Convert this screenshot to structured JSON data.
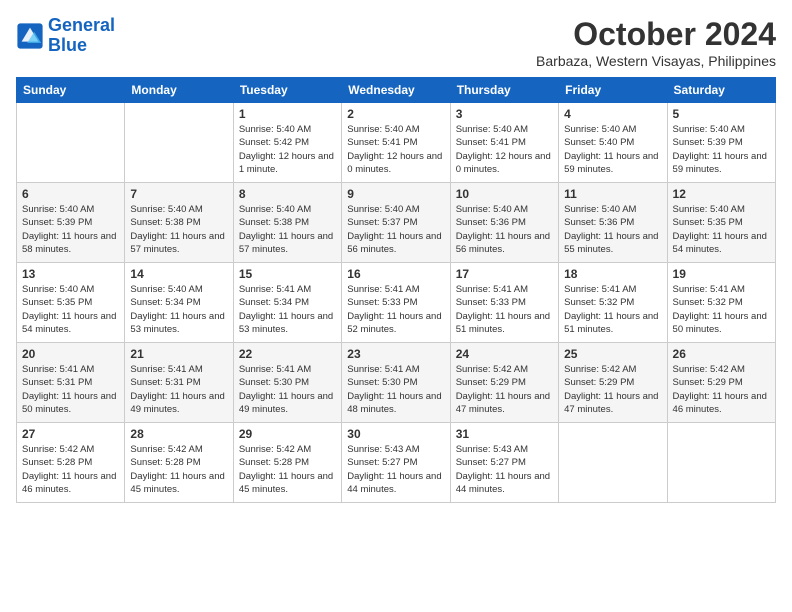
{
  "header": {
    "logo_line1": "General",
    "logo_line2": "Blue",
    "month": "October 2024",
    "location": "Barbaza, Western Visayas, Philippines"
  },
  "weekdays": [
    "Sunday",
    "Monday",
    "Tuesday",
    "Wednesday",
    "Thursday",
    "Friday",
    "Saturday"
  ],
  "weeks": [
    [
      {
        "day": "",
        "sunrise": "",
        "sunset": "",
        "daylight": ""
      },
      {
        "day": "",
        "sunrise": "",
        "sunset": "",
        "daylight": ""
      },
      {
        "day": "1",
        "sunrise": "Sunrise: 5:40 AM",
        "sunset": "Sunset: 5:42 PM",
        "daylight": "Daylight: 12 hours and 1 minute."
      },
      {
        "day": "2",
        "sunrise": "Sunrise: 5:40 AM",
        "sunset": "Sunset: 5:41 PM",
        "daylight": "Daylight: 12 hours and 0 minutes."
      },
      {
        "day": "3",
        "sunrise": "Sunrise: 5:40 AM",
        "sunset": "Sunset: 5:41 PM",
        "daylight": "Daylight: 12 hours and 0 minutes."
      },
      {
        "day": "4",
        "sunrise": "Sunrise: 5:40 AM",
        "sunset": "Sunset: 5:40 PM",
        "daylight": "Daylight: 11 hours and 59 minutes."
      },
      {
        "day": "5",
        "sunrise": "Sunrise: 5:40 AM",
        "sunset": "Sunset: 5:39 PM",
        "daylight": "Daylight: 11 hours and 59 minutes."
      }
    ],
    [
      {
        "day": "6",
        "sunrise": "Sunrise: 5:40 AM",
        "sunset": "Sunset: 5:39 PM",
        "daylight": "Daylight: 11 hours and 58 minutes."
      },
      {
        "day": "7",
        "sunrise": "Sunrise: 5:40 AM",
        "sunset": "Sunset: 5:38 PM",
        "daylight": "Daylight: 11 hours and 57 minutes."
      },
      {
        "day": "8",
        "sunrise": "Sunrise: 5:40 AM",
        "sunset": "Sunset: 5:38 PM",
        "daylight": "Daylight: 11 hours and 57 minutes."
      },
      {
        "day": "9",
        "sunrise": "Sunrise: 5:40 AM",
        "sunset": "Sunset: 5:37 PM",
        "daylight": "Daylight: 11 hours and 56 minutes."
      },
      {
        "day": "10",
        "sunrise": "Sunrise: 5:40 AM",
        "sunset": "Sunset: 5:36 PM",
        "daylight": "Daylight: 11 hours and 56 minutes."
      },
      {
        "day": "11",
        "sunrise": "Sunrise: 5:40 AM",
        "sunset": "Sunset: 5:36 PM",
        "daylight": "Daylight: 11 hours and 55 minutes."
      },
      {
        "day": "12",
        "sunrise": "Sunrise: 5:40 AM",
        "sunset": "Sunset: 5:35 PM",
        "daylight": "Daylight: 11 hours and 54 minutes."
      }
    ],
    [
      {
        "day": "13",
        "sunrise": "Sunrise: 5:40 AM",
        "sunset": "Sunset: 5:35 PM",
        "daylight": "Daylight: 11 hours and 54 minutes."
      },
      {
        "day": "14",
        "sunrise": "Sunrise: 5:40 AM",
        "sunset": "Sunset: 5:34 PM",
        "daylight": "Daylight: 11 hours and 53 minutes."
      },
      {
        "day": "15",
        "sunrise": "Sunrise: 5:41 AM",
        "sunset": "Sunset: 5:34 PM",
        "daylight": "Daylight: 11 hours and 53 minutes."
      },
      {
        "day": "16",
        "sunrise": "Sunrise: 5:41 AM",
        "sunset": "Sunset: 5:33 PM",
        "daylight": "Daylight: 11 hours and 52 minutes."
      },
      {
        "day": "17",
        "sunrise": "Sunrise: 5:41 AM",
        "sunset": "Sunset: 5:33 PM",
        "daylight": "Daylight: 11 hours and 51 minutes."
      },
      {
        "day": "18",
        "sunrise": "Sunrise: 5:41 AM",
        "sunset": "Sunset: 5:32 PM",
        "daylight": "Daylight: 11 hours and 51 minutes."
      },
      {
        "day": "19",
        "sunrise": "Sunrise: 5:41 AM",
        "sunset": "Sunset: 5:32 PM",
        "daylight": "Daylight: 11 hours and 50 minutes."
      }
    ],
    [
      {
        "day": "20",
        "sunrise": "Sunrise: 5:41 AM",
        "sunset": "Sunset: 5:31 PM",
        "daylight": "Daylight: 11 hours and 50 minutes."
      },
      {
        "day": "21",
        "sunrise": "Sunrise: 5:41 AM",
        "sunset": "Sunset: 5:31 PM",
        "daylight": "Daylight: 11 hours and 49 minutes."
      },
      {
        "day": "22",
        "sunrise": "Sunrise: 5:41 AM",
        "sunset": "Sunset: 5:30 PM",
        "daylight": "Daylight: 11 hours and 49 minutes."
      },
      {
        "day": "23",
        "sunrise": "Sunrise: 5:41 AM",
        "sunset": "Sunset: 5:30 PM",
        "daylight": "Daylight: 11 hours and 48 minutes."
      },
      {
        "day": "24",
        "sunrise": "Sunrise: 5:42 AM",
        "sunset": "Sunset: 5:29 PM",
        "daylight": "Daylight: 11 hours and 47 minutes."
      },
      {
        "day": "25",
        "sunrise": "Sunrise: 5:42 AM",
        "sunset": "Sunset: 5:29 PM",
        "daylight": "Daylight: 11 hours and 47 minutes."
      },
      {
        "day": "26",
        "sunrise": "Sunrise: 5:42 AM",
        "sunset": "Sunset: 5:29 PM",
        "daylight": "Daylight: 11 hours and 46 minutes."
      }
    ],
    [
      {
        "day": "27",
        "sunrise": "Sunrise: 5:42 AM",
        "sunset": "Sunset: 5:28 PM",
        "daylight": "Daylight: 11 hours and 46 minutes."
      },
      {
        "day": "28",
        "sunrise": "Sunrise: 5:42 AM",
        "sunset": "Sunset: 5:28 PM",
        "daylight": "Daylight: 11 hours and 45 minutes."
      },
      {
        "day": "29",
        "sunrise": "Sunrise: 5:42 AM",
        "sunset": "Sunset: 5:28 PM",
        "daylight": "Daylight: 11 hours and 45 minutes."
      },
      {
        "day": "30",
        "sunrise": "Sunrise: 5:43 AM",
        "sunset": "Sunset: 5:27 PM",
        "daylight": "Daylight: 11 hours and 44 minutes."
      },
      {
        "day": "31",
        "sunrise": "Sunrise: 5:43 AM",
        "sunset": "Sunset: 5:27 PM",
        "daylight": "Daylight: 11 hours and 44 minutes."
      },
      {
        "day": "",
        "sunrise": "",
        "sunset": "",
        "daylight": ""
      },
      {
        "day": "",
        "sunrise": "",
        "sunset": "",
        "daylight": ""
      }
    ]
  ]
}
